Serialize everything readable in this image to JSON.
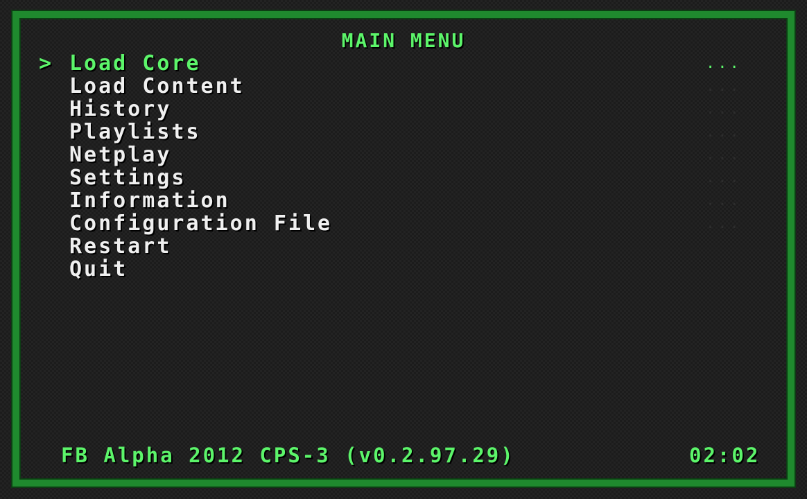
{
  "header": {
    "title": "MAIN MENU",
    "cursor": ">"
  },
  "menu": {
    "items": [
      {
        "label": "Load Core",
        "value": "...",
        "selected": true
      },
      {
        "label": "Load Content",
        "value": "...",
        "selected": false
      },
      {
        "label": "History",
        "value": "...",
        "selected": false
      },
      {
        "label": "Playlists",
        "value": "...",
        "selected": false
      },
      {
        "label": "Netplay",
        "value": "...",
        "selected": false
      },
      {
        "label": "Settings",
        "value": "...",
        "selected": false
      },
      {
        "label": "Information",
        "value": "...",
        "selected": false
      },
      {
        "label": "Configuration File",
        "value": "...",
        "selected": false
      },
      {
        "label": "Restart",
        "value": "",
        "selected": false
      },
      {
        "label": "Quit",
        "value": "",
        "selected": false
      }
    ]
  },
  "footer": {
    "core_info": "FB Alpha 2012 CPS-3 (v0.2.97.29)",
    "clock": "02:02"
  },
  "colors": {
    "accent": "#5cf56a",
    "frame": "#1f8a2e",
    "text": "#f0f0f0",
    "background": "#1c1c1c"
  }
}
